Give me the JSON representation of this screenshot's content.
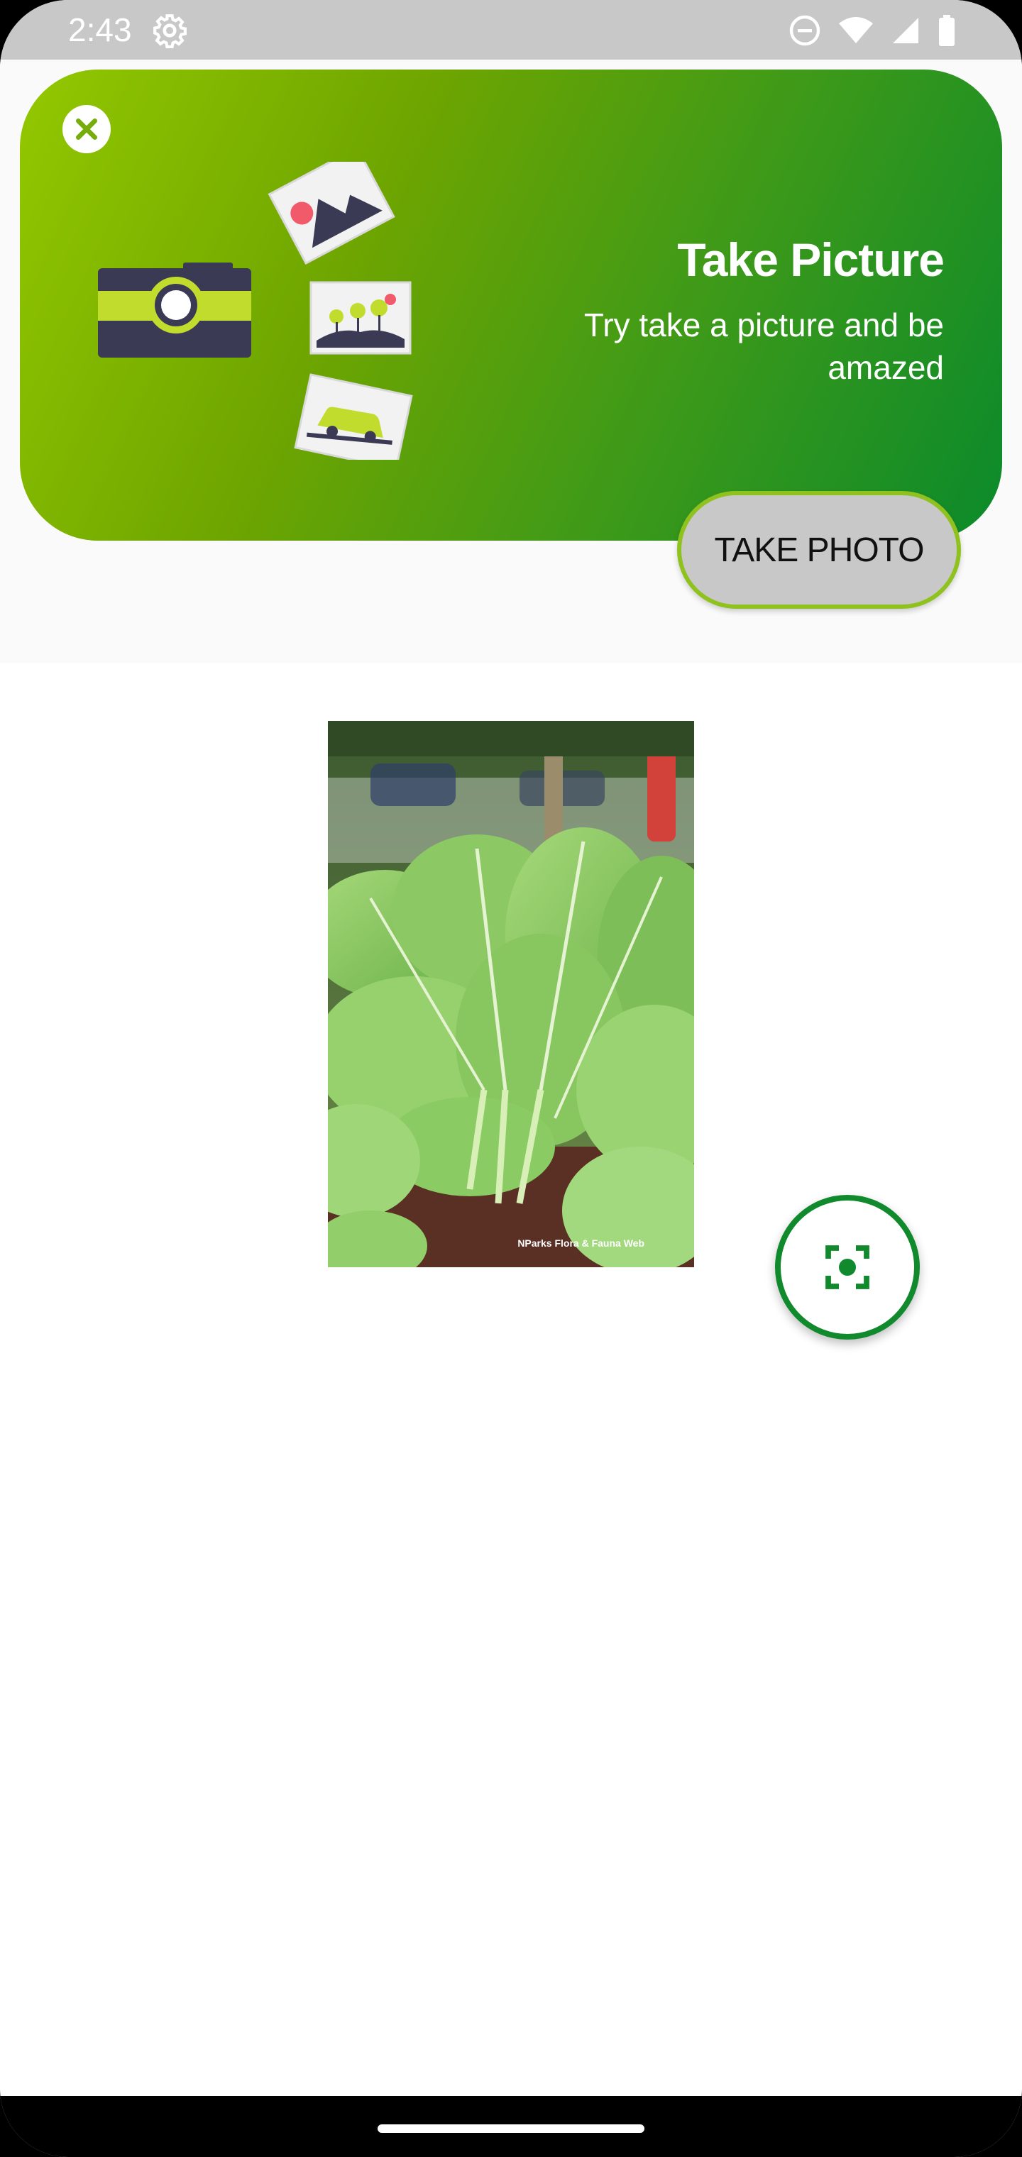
{
  "status_bar": {
    "time": "2:43",
    "icons": [
      "settings-gear-icon",
      "do-not-disturb-icon",
      "wifi-icon",
      "signal-icon",
      "battery-icon"
    ]
  },
  "banner": {
    "title": "Take Picture",
    "subtitle": "Try take a picture and be amazed",
    "button_label": "TAKE PHOTO",
    "close_icon": "close-icon",
    "illustration": "camera-and-photos-illustration",
    "gradient_colors": [
      "#93c800",
      "#0b8a2b"
    ]
  },
  "photo": {
    "description": "mustard-greens-plant-photo",
    "watermark": "NParks Flora & Fauna Web"
  },
  "scan_button": {
    "icon": "scan-focus-icon",
    "accent": "#108a2c"
  },
  "nav": {
    "handle": "home-gesture-handle"
  }
}
